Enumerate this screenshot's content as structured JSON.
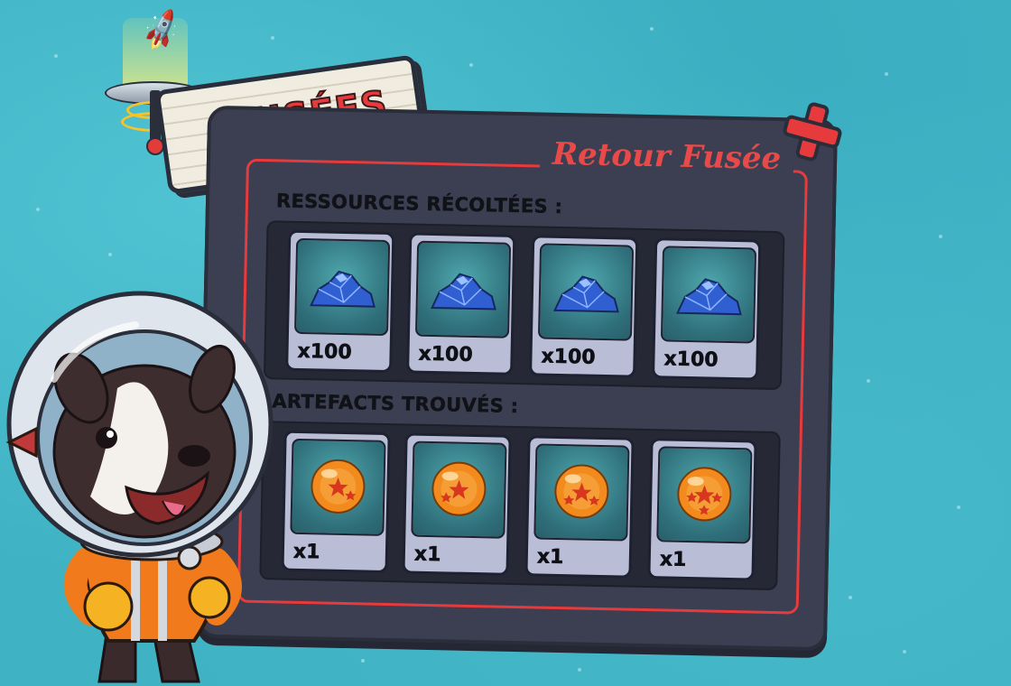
{
  "header": {
    "sign_title": "FUSÉES"
  },
  "panel": {
    "title": "Retour Fusée",
    "resources": {
      "label": "RESSOURCES RÉCOLTÉES :",
      "items": [
        {
          "icon": "blue-ore-icon",
          "qty": "x100"
        },
        {
          "icon": "blue-ore-icon",
          "qty": "x100"
        },
        {
          "icon": "blue-ore-icon",
          "qty": "x100"
        },
        {
          "icon": "blue-ore-icon",
          "qty": "x100"
        }
      ]
    },
    "artefacts": {
      "label": "ARTEFACTS TROUVÉS :",
      "items": [
        {
          "icon": "orange-star-orb-icon",
          "qty": "x1"
        },
        {
          "icon": "orange-star-orb-icon",
          "qty": "x1"
        },
        {
          "icon": "orange-star-orb-icon",
          "qty": "x1"
        },
        {
          "icon": "orange-star-orb-icon",
          "qty": "x1"
        }
      ]
    }
  },
  "controls": {
    "close_icon": "close-x-icon"
  },
  "colors": {
    "accent_red": "#e73a3d",
    "panel_bg": "#3b3f51",
    "card_bg": "#b9bdd6",
    "water": "#3fb3c4"
  }
}
